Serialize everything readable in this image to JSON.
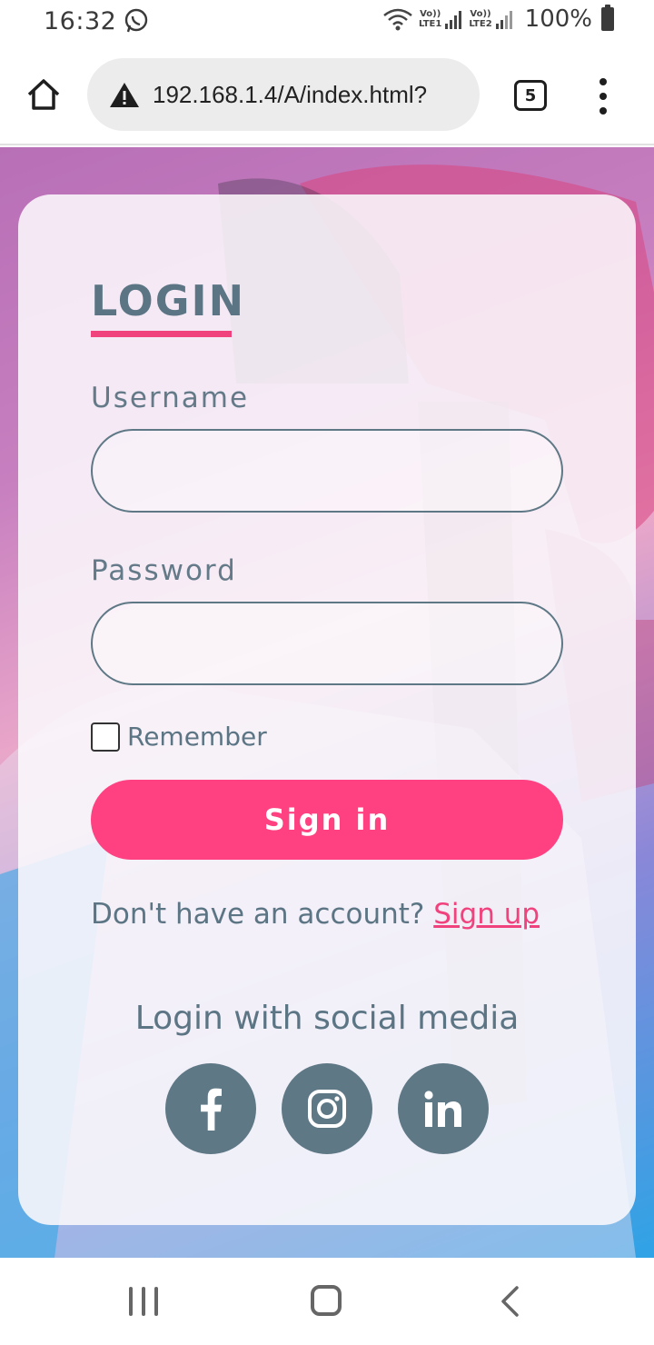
{
  "status_bar": {
    "time": "16:32",
    "sim1": [
      "Vo))",
      "LTE1"
    ],
    "sim2": [
      "Vo))",
      "LTE2"
    ],
    "battery": "100%",
    "icons": [
      "whatsapp-icon",
      "wifi-icon",
      "signal-icon",
      "battery-icon"
    ]
  },
  "browser": {
    "url": "192.168.1.4/A/index.html?",
    "tab_count": "5",
    "icons": [
      "home-icon",
      "warning-icon",
      "tabs-icon",
      "more-vert-icon"
    ]
  },
  "login": {
    "title": "LOGIN",
    "username_label": "Username",
    "username_value": "",
    "password_label": "Password",
    "password_value": "",
    "remember_label": "Remember",
    "remember_checked": false,
    "signin_label": "Sign in",
    "no_account_text": "Don't have an account? ",
    "signup_label": "Sign up",
    "social_title": "Login with social media",
    "social": [
      "facebook-icon",
      "instagram-icon",
      "linkedin-icon"
    ]
  },
  "colors": {
    "accent": "#ff4081",
    "slate": "#5f7886"
  },
  "nav_bar": {
    "icons": [
      "recent-apps-icon",
      "home-icon",
      "back-icon"
    ]
  }
}
